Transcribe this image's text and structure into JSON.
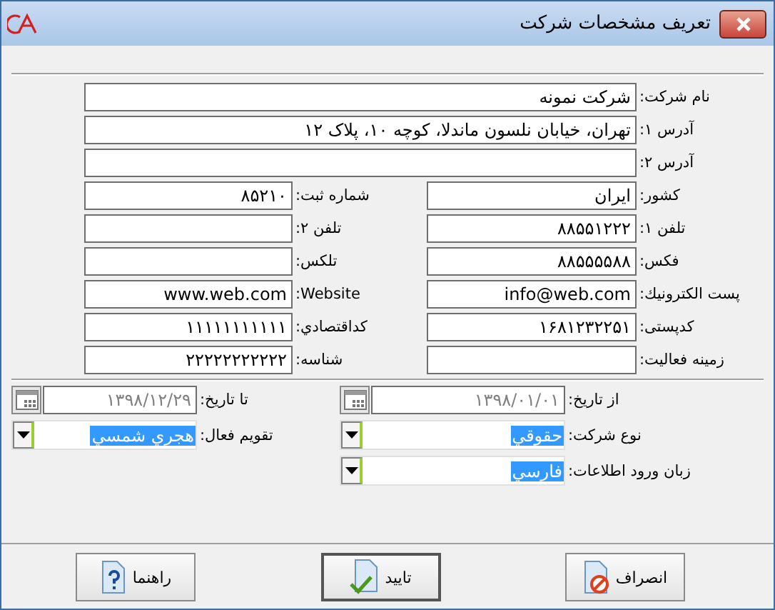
{
  "window": {
    "title": "تعریف مشخصات شرکت"
  },
  "wide_fields": [
    {
      "label": "نام شرکت:",
      "value": "شرکت نمونه"
    },
    {
      "label": "آدرس ۱:",
      "value": "تهران، خیابان نلسون ماندلا، کوچه ۱۰، پلاک ۱۲"
    },
    {
      "label": "آدرس ۲:"
    }
  ],
  "field_rows": [
    [
      {
        "label": "کشور:",
        "value": "ایران"
      },
      {
        "label": "شماره ثبت:",
        "value": "۸۵۲۱۰"
      }
    ],
    [
      {
        "label": "تلفن ۱:",
        "value": "۸۸۵۵۱۲۲۲"
      },
      {
        "label": "تلفن ۲:"
      }
    ],
    [
      {
        "label": "فکس:",
        "value": "۸۸۵۵۵۵۸۸"
      },
      {
        "label": "تلکس:"
      }
    ],
    [
      {
        "label": "پست الکترونیك:",
        "value": "info@web.com"
      },
      {
        "label": "Website:",
        "value": "www.web.com"
      }
    ],
    [
      {
        "label": "کدپستی:",
        "value": "۱۶۸۱۲۳۲۲۵۱"
      },
      {
        "label": "کداقتصادي:",
        "value": "۱۱۱۱۱۱۱۱۱۱۱"
      }
    ],
    [
      {
        "label": "زمینه فعالیت:"
      },
      {
        "label": "شناسه:",
        "value": "۲۲۲۲۲۲۲۲۲۲۲"
      }
    ]
  ],
  "options": [
    {
      "kind": "date",
      "label": "از تاریخ:",
      "value": "۱۳۹۸/۰۱/۰۱",
      "disabled": true
    },
    {
      "kind": "date",
      "label": "تا تاریخ:",
      "value": "۱۳۹۸/۱۲/۲۹",
      "disabled": true
    },
    {
      "kind": "combo",
      "label": "نوع شرکت:",
      "value": "حقوقي",
      "highlighted": true
    },
    {
      "kind": "combo",
      "label": "تقویم فعال:",
      "value": "هجري شمسي",
      "highlighted": true
    },
    {
      "kind": "combo",
      "label": "زبان ورود اطلاعات:",
      "value": "فارسي",
      "highlighted": true
    }
  ],
  "buttons": [
    {
      "kind": "cancel",
      "label": "انصراف",
      "default": false
    },
    {
      "kind": "ok",
      "label": "تایید",
      "default": true
    },
    {
      "kind": "help",
      "label": "راهنما",
      "default": false
    }
  ]
}
